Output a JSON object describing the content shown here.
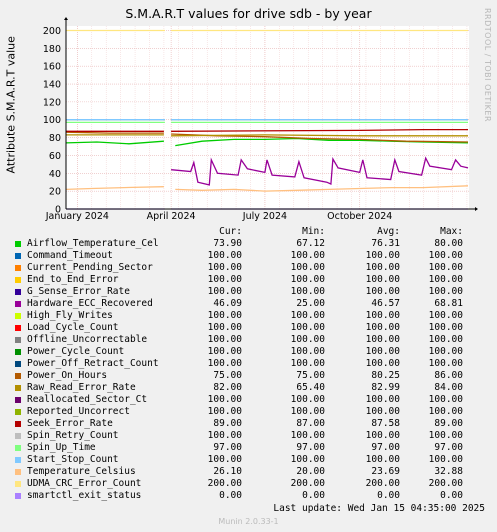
{
  "graph": {
    "title": "S.M.A.R.T values for drive sdb - by year",
    "watermark": "RRDTOOL / TOBI OETIKER",
    "last_update": "Last update:  Wed Jan 15 04:35:00 2025",
    "version": "Munin 2.0.33-1",
    "col_headers": [
      "Cur:",
      "Min:",
      "Avg:",
      "Max:"
    ]
  },
  "chart_data": {
    "type": "line",
    "title": "S.M.A.R.T values for drive sdb - by year",
    "xlabel": "",
    "ylabel": "Attribute S.M.A.R.T value",
    "ylim": [
      0,
      205
    ],
    "yticks": [
      0,
      20,
      40,
      60,
      80,
      100,
      120,
      140,
      160,
      180,
      200
    ],
    "xlim": [
      "2024-01-01",
      "2025-01-15"
    ],
    "xticks": [
      {
        "label": "January 2024",
        "date": "2024-01-01"
      },
      {
        "label": "April 2024",
        "date": "2024-04-01"
      },
      {
        "label": "July 2024",
        "date": "2024-07-01"
      },
      {
        "label": "October 2024",
        "date": "2024-10-01"
      }
    ],
    "gap": [
      "2024-03-26",
      "2024-04-01"
    ],
    "grid": true,
    "legend_position": "bottom",
    "series": [
      {
        "name": "Airflow_Temperature_Cel",
        "color": "#00cc00",
        "values": {
          "cur": "73.90",
          "min": "67.12",
          "avg": "76.31",
          "max": "80.00"
        },
        "points": [
          [
            "2023-12-21",
            74
          ],
          [
            "2024-01-20",
            75
          ],
          [
            "2024-02-20",
            73
          ],
          [
            "2024-03-25",
            76
          ],
          [
            "2024-04-05",
            71
          ],
          [
            "2024-05-01",
            76
          ],
          [
            "2024-06-01",
            78
          ],
          [
            "2024-07-01",
            78
          ],
          [
            "2024-08-01",
            79
          ],
          [
            "2024-09-01",
            77
          ],
          [
            "2024-10-01",
            77
          ],
          [
            "2024-11-01",
            76
          ],
          [
            "2024-12-01",
            75
          ],
          [
            "2025-01-14",
            74
          ]
        ]
      },
      {
        "name": "Command_Timeout",
        "color": "#0066b3",
        "values": {
          "cur": "100.00",
          "min": "100.00",
          "avg": "100.00",
          "max": "100.00"
        },
        "points": [
          [
            "2023-12-21",
            100
          ],
          [
            "2025-01-14",
            100
          ]
        ]
      },
      {
        "name": "Current_Pending_Sector",
        "color": "#ff8000",
        "values": {
          "cur": "100.00",
          "min": "100.00",
          "avg": "100.00",
          "max": "100.00"
        },
        "points": [
          [
            "2023-12-21",
            100
          ],
          [
            "2025-01-14",
            100
          ]
        ]
      },
      {
        "name": "End_to_End_Error",
        "color": "#ffcc00",
        "values": {
          "cur": "100.00",
          "min": "100.00",
          "avg": "100.00",
          "max": "100.00"
        },
        "points": [
          [
            "2023-12-21",
            100
          ],
          [
            "2025-01-14",
            100
          ]
        ]
      },
      {
        "name": "G_Sense_Error_Rate",
        "color": "#330099",
        "values": {
          "cur": "100.00",
          "min": "100.00",
          "avg": "100.00",
          "max": "100.00"
        },
        "points": [
          [
            "2023-12-21",
            100
          ],
          [
            "2025-01-14",
            100
          ]
        ]
      },
      {
        "name": "Hardware_ECC_Recovered",
        "color": "#990099",
        "values": {
          "cur": "46.09",
          "min": "25.00",
          "avg": "46.57",
          "max": "68.81"
        },
        "points": [
          [
            "2024-04-01",
            44
          ],
          [
            "2024-04-20",
            42
          ],
          [
            "2024-04-23",
            52
          ],
          [
            "2024-04-27",
            30
          ],
          [
            "2024-05-08",
            27
          ],
          [
            "2024-05-10",
            55
          ],
          [
            "2024-05-16",
            40
          ],
          [
            "2024-06-05",
            38
          ],
          [
            "2024-06-08",
            55
          ],
          [
            "2024-06-14",
            45
          ],
          [
            "2024-07-01",
            41
          ],
          [
            "2024-07-03",
            55
          ],
          [
            "2024-07-08",
            38
          ],
          [
            "2024-07-30",
            36
          ],
          [
            "2024-08-03",
            53
          ],
          [
            "2024-08-08",
            35
          ],
          [
            "2024-08-30",
            30
          ],
          [
            "2024-09-03",
            28
          ],
          [
            "2024-09-05",
            56
          ],
          [
            "2024-09-10",
            46
          ],
          [
            "2024-10-01",
            41
          ],
          [
            "2024-10-04",
            55
          ],
          [
            "2024-10-08",
            35
          ],
          [
            "2024-10-31",
            33
          ],
          [
            "2024-11-04",
            55
          ],
          [
            "2024-11-08",
            42
          ],
          [
            "2024-11-30",
            38
          ],
          [
            "2024-12-04",
            57
          ],
          [
            "2024-12-08",
            48
          ],
          [
            "2024-12-29",
            44
          ],
          [
            "2025-01-02",
            55
          ],
          [
            "2025-01-07",
            48
          ],
          [
            "2025-01-14",
            46
          ]
        ]
      },
      {
        "name": "High_Fly_Writes",
        "color": "#ccff00",
        "values": {
          "cur": "100.00",
          "min": "100.00",
          "avg": "100.00",
          "max": "100.00"
        },
        "points": [
          [
            "2023-12-21",
            100
          ],
          [
            "2025-01-14",
            100
          ]
        ]
      },
      {
        "name": "Load_Cycle_Count",
        "color": "#ff0000",
        "values": {
          "cur": "100.00",
          "min": "100.00",
          "avg": "100.00",
          "max": "100.00"
        },
        "points": [
          [
            "2023-12-21",
            100
          ],
          [
            "2025-01-14",
            100
          ]
        ]
      },
      {
        "name": "Offline_Uncorrectable",
        "color": "#808080",
        "values": {
          "cur": "100.00",
          "min": "100.00",
          "avg": "100.00",
          "max": "100.00"
        },
        "points": [
          [
            "2023-12-21",
            100
          ],
          [
            "2025-01-14",
            100
          ]
        ]
      },
      {
        "name": "Power_Cycle_Count",
        "color": "#008f00",
        "values": {
          "cur": "100.00",
          "min": "100.00",
          "avg": "100.00",
          "max": "100.00"
        },
        "points": [
          [
            "2023-12-21",
            100
          ],
          [
            "2025-01-14",
            100
          ]
        ]
      },
      {
        "name": "Power_Off_Retract_Count",
        "color": "#00487d",
        "values": {
          "cur": "100.00",
          "min": "100.00",
          "avg": "100.00",
          "max": "100.00"
        },
        "points": [
          [
            "2023-12-21",
            100
          ],
          [
            "2025-01-14",
            100
          ]
        ]
      },
      {
        "name": "Power_On_Hours",
        "color": "#b35a00",
        "values": {
          "cur": "75.00",
          "min": "75.00",
          "avg": "80.25",
          "max": "86.00"
        },
        "points": [
          [
            "2023-12-21",
            86
          ],
          [
            "2024-02-01",
            85
          ],
          [
            "2024-03-25",
            85
          ],
          [
            "2024-04-01",
            84
          ],
          [
            "2024-05-15",
            82
          ],
          [
            "2024-07-01",
            81
          ],
          [
            "2024-08-15",
            79
          ],
          [
            "2024-10-01",
            78
          ],
          [
            "2024-11-15",
            76
          ],
          [
            "2025-01-14",
            75
          ]
        ]
      },
      {
        "name": "Raw_Read_Error_Rate",
        "color": "#b38f00",
        "values": {
          "cur": "82.00",
          "min": "65.40",
          "avg": "82.99",
          "max": "84.00"
        },
        "points": [
          [
            "2023-12-21",
            83
          ],
          [
            "2024-03-25",
            83
          ],
          [
            "2024-04-01",
            82
          ],
          [
            "2024-07-01",
            83
          ],
          [
            "2024-10-01",
            82
          ],
          [
            "2025-01-14",
            82
          ]
        ]
      },
      {
        "name": "Reallocated_Sector_Ct",
        "color": "#6b006b",
        "values": {
          "cur": "100.00",
          "min": "100.00",
          "avg": "100.00",
          "max": "100.00"
        },
        "points": [
          [
            "2023-12-21",
            100
          ],
          [
            "2025-01-14",
            100
          ]
        ]
      },
      {
        "name": "Reported_Uncorrect",
        "color": "#8fb300",
        "values": {
          "cur": "100.00",
          "min": "100.00",
          "avg": "100.00",
          "max": "100.00"
        },
        "points": [
          [
            "2023-12-21",
            100
          ],
          [
            "2025-01-14",
            100
          ]
        ]
      },
      {
        "name": "Seek_Error_Rate",
        "color": "#b30000",
        "values": {
          "cur": "89.00",
          "min": "87.00",
          "avg": "87.58",
          "max": "89.00"
        },
        "points": [
          [
            "2023-12-21",
            87
          ],
          [
            "2024-03-25",
            87
          ],
          [
            "2024-04-01",
            87
          ],
          [
            "2024-10-01",
            88
          ],
          [
            "2024-12-01",
            89
          ],
          [
            "2025-01-14",
            89
          ]
        ]
      },
      {
        "name": "Spin_Retry_Count",
        "color": "#bebebe",
        "values": {
          "cur": "100.00",
          "min": "100.00",
          "avg": "100.00",
          "max": "100.00"
        },
        "points": [
          [
            "2023-12-21",
            100
          ],
          [
            "2025-01-14",
            100
          ]
        ]
      },
      {
        "name": "Spin_Up_Time",
        "color": "#80ff80",
        "values": {
          "cur": "97.00",
          "min": "97.00",
          "avg": "97.00",
          "max": "97.00"
        },
        "points": [
          [
            "2023-12-21",
            97
          ],
          [
            "2025-01-14",
            97
          ]
        ]
      },
      {
        "name": "Start_Stop_Count",
        "color": "#80c9ff",
        "values": {
          "cur": "100.00",
          "min": "100.00",
          "avg": "100.00",
          "max": "100.00"
        },
        "points": [
          [
            "2023-12-21",
            100
          ],
          [
            "2025-01-14",
            100
          ]
        ]
      },
      {
        "name": "Temperature_Celsius",
        "color": "#ffc080",
        "values": {
          "cur": "26.10",
          "min": "20.00",
          "avg": "23.69",
          "max": "32.88"
        },
        "points": [
          [
            "2023-12-21",
            22
          ],
          [
            "2024-01-15",
            23
          ],
          [
            "2024-02-15",
            24
          ],
          [
            "2024-03-25",
            25
          ],
          [
            "2024-04-05",
            22
          ],
          [
            "2024-05-01",
            21
          ],
          [
            "2024-06-01",
            22
          ],
          [
            "2024-07-01",
            20
          ],
          [
            "2024-08-01",
            21
          ],
          [
            "2024-09-01",
            22
          ],
          [
            "2024-10-01",
            23
          ],
          [
            "2024-11-01",
            24
          ],
          [
            "2024-12-01",
            24
          ],
          [
            "2025-01-14",
            26
          ]
        ]
      },
      {
        "name": "UDMA_CRC_Error_Count",
        "color": "#ffe680",
        "values": {
          "cur": "200.00",
          "min": "200.00",
          "avg": "200.00",
          "max": "200.00"
        },
        "points": [
          [
            "2023-12-21",
            200
          ],
          [
            "2025-01-14",
            200
          ]
        ]
      },
      {
        "name": "smartctl_exit_status",
        "color": "#aa80ff",
        "values": {
          "cur": "0.00",
          "min": "0.00",
          "avg": "0.00",
          "max": "0.00"
        },
        "points": [
          [
            "2023-12-21",
            0
          ],
          [
            "2025-01-14",
            0
          ]
        ]
      }
    ]
  }
}
